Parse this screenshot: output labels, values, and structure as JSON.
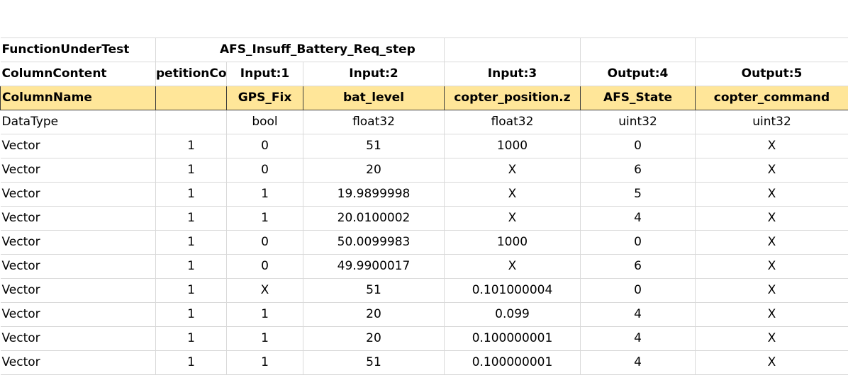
{
  "sheet": {
    "function_row": {
      "label": "FunctionUnderTest",
      "function_name": "AFS_Insuff_Battery_Req_step"
    },
    "content_row": {
      "label": "ColumnContent",
      "cells": [
        "petitionCo",
        "Input:1",
        "Input:2",
        "Input:3",
        "Output:4",
        "Output:5"
      ]
    },
    "name_row": {
      "label": "ColumnName",
      "cells": [
        "",
        "GPS_Fix",
        "bat_level",
        "copter_position.z",
        "AFS_State",
        "copter_command"
      ]
    },
    "type_row": {
      "label": "DataType",
      "cells": [
        "",
        "bool",
        "float32",
        "float32",
        "uint32",
        "uint32"
      ]
    },
    "rows": [
      {
        "label": "Vector",
        "cells": [
          "1",
          "0",
          "51",
          "1000",
          "0",
          "X"
        ]
      },
      {
        "label": "Vector",
        "cells": [
          "1",
          "0",
          "20",
          "X",
          "6",
          "X"
        ]
      },
      {
        "label": "Vector",
        "cells": [
          "1",
          "1",
          "19.9899998",
          "X",
          "5",
          "X"
        ]
      },
      {
        "label": "Vector",
        "cells": [
          "1",
          "1",
          "20.0100002",
          "X",
          "4",
          "X"
        ]
      },
      {
        "label": "Vector",
        "cells": [
          "1",
          "0",
          "50.0099983",
          "1000",
          "0",
          "X"
        ]
      },
      {
        "label": "Vector",
        "cells": [
          "1",
          "0",
          "49.9900017",
          "X",
          "6",
          "X"
        ]
      },
      {
        "label": "Vector",
        "cells": [
          "1",
          "X",
          "51",
          "0.101000004",
          "0",
          "X"
        ]
      },
      {
        "label": "Vector",
        "cells": [
          "1",
          "1",
          "20",
          "0.099",
          "4",
          "X"
        ]
      },
      {
        "label": "Vector",
        "cells": [
          "1",
          "1",
          "20",
          "0.100000001",
          "4",
          "X"
        ]
      },
      {
        "label": "Vector",
        "cells": [
          "1",
          "1",
          "51",
          "0.100000001",
          "4",
          "X"
        ]
      }
    ],
    "highlight_color": "#ffe699"
  }
}
